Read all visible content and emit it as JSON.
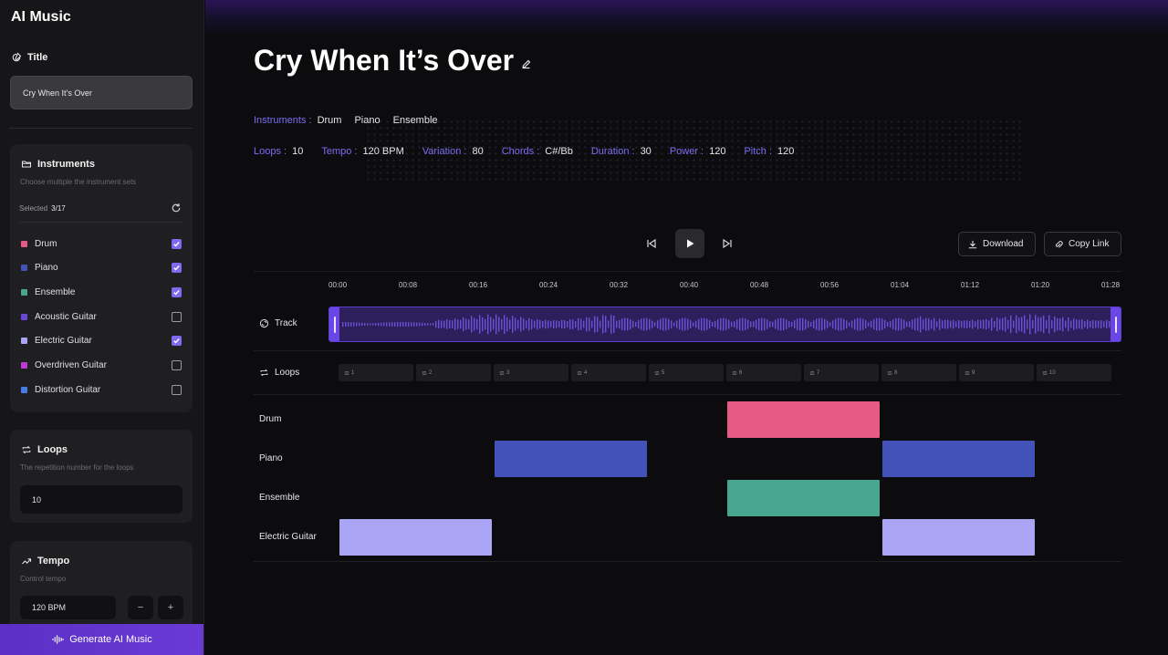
{
  "app": {
    "brand": "AI Music"
  },
  "sidebar": {
    "title_section": {
      "heading": "Title",
      "value": "Cry When It’s Over"
    },
    "instruments": {
      "heading": "Instruments",
      "description": "Choose multiple the instrument sets",
      "selected_label": "Selected",
      "selected_count": "3/17",
      "items": [
        {
          "label": "Drum",
          "color": "#e75a85",
          "checked": true
        },
        {
          "label": "Piano",
          "color": "#4352b8",
          "checked": true
        },
        {
          "label": "Ensemble",
          "color": "#48a590",
          "checked": true
        },
        {
          "label": "Acoustic Guitar",
          "color": "#6a46d6",
          "checked": false
        },
        {
          "label": "Electric Guitar",
          "color": "#aaa5f5",
          "checked": true
        },
        {
          "label": "Overdriven Guitar",
          "color": "#c03ad8",
          "checked": false
        },
        {
          "label": "Distortion Guitar",
          "color": "#4a7ae6",
          "checked": false
        }
      ]
    },
    "loops": {
      "heading": "Loops",
      "description": "The repetition number for the loops",
      "value": "10"
    },
    "tempo": {
      "heading": "Tempo",
      "description": "Control tempo",
      "value": "120 BPM",
      "minus": "−",
      "plus": "+"
    },
    "generate_label": "Generate AI Music"
  },
  "main": {
    "title": "Cry When It’s Over",
    "instruments_label": "Instruments :",
    "instruments": [
      "Drum",
      "Piano",
      "Ensemble"
    ],
    "params": [
      {
        "label": "Loops :",
        "value": "10"
      },
      {
        "label": "Tempo :",
        "value": "120 BPM"
      },
      {
        "label": "Variation :",
        "value": "80"
      },
      {
        "label": "Chords :",
        "value": "C#/Bb"
      },
      {
        "label": "Duration :",
        "value": "30"
      },
      {
        "label": "Power :",
        "value": "120"
      },
      {
        "label": "Pitch :",
        "value": "120"
      }
    ],
    "download_label": "Download",
    "copy_link_label": "Copy Link",
    "timeline_ticks": [
      "00:00",
      "00:08",
      "00:16",
      "00:24",
      "00:32",
      "00:40",
      "00:48",
      "00:56",
      "01:04",
      "01:12",
      "01:20",
      "01:28"
    ],
    "track_label": "Track",
    "loops_label": "Loops",
    "loop_numbers": [
      "1",
      "2",
      "3",
      "4",
      "5",
      "6",
      "7",
      "8",
      "9",
      "10"
    ],
    "lanes": [
      {
        "label": "Drum",
        "color": "#e75a85",
        "blocks": [
          [
            5,
            7
          ]
        ]
      },
      {
        "label": "Piano",
        "color": "#4352b8",
        "blocks": [
          [
            2,
            4
          ],
          [
            7,
            9
          ]
        ]
      },
      {
        "label": "Ensemble",
        "color": "#48a590",
        "blocks": [
          [
            5,
            7
          ]
        ]
      },
      {
        "label": "Electric Guitar",
        "color": "#aaa5f5",
        "blocks": [
          [
            0,
            2
          ],
          [
            7,
            9
          ]
        ]
      }
    ]
  }
}
